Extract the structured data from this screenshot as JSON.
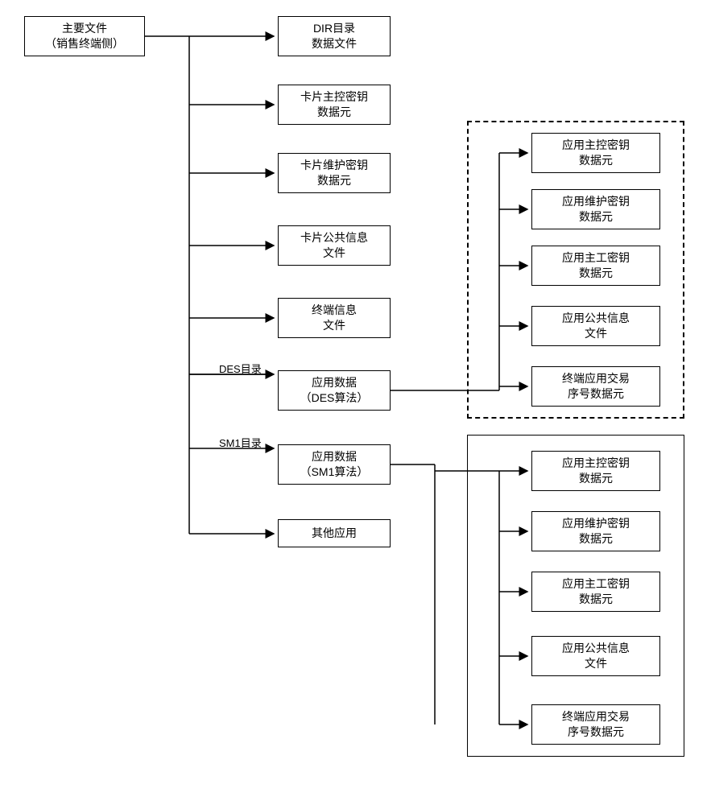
{
  "root": {
    "line1": "主要文件",
    "line2": "（销售终端侧）"
  },
  "col2": {
    "b1": {
      "line1": "DIR目录",
      "line2": "数据文件"
    },
    "b2": {
      "line1": "卡片主控密钥",
      "line2": "数据元"
    },
    "b3": {
      "line1": "卡片维护密钥",
      "line2": "数据元"
    },
    "b4": {
      "line1": "卡片公共信息",
      "line2": "文件"
    },
    "b5": {
      "line1": "终端信息",
      "line2": "文件"
    },
    "b6": {
      "line1": "应用数据",
      "line2": "（DES算法）",
      "label": "DES目录"
    },
    "b7": {
      "line1": "应用数据",
      "line2": "（SM1算法）",
      "label": "SM1目录"
    },
    "b8": {
      "line1": "其他应用"
    }
  },
  "group_des": {
    "g1": {
      "line1": "应用主控密钥",
      "line2": "数据元"
    },
    "g2": {
      "line1": "应用维护密钥",
      "line2": "数据元"
    },
    "g3": {
      "line1": "应用主工密钥",
      "line2": "数据元"
    },
    "g4": {
      "line1": "应用公共信息",
      "line2": "文件"
    },
    "g5": {
      "line1": "终端应用交易",
      "line2": "序号数据元"
    }
  },
  "group_sm1": {
    "g1": {
      "line1": "应用主控密钥",
      "line2": "数据元"
    },
    "g2": {
      "line1": "应用维护密钥",
      "line2": "数据元"
    },
    "g3": {
      "line1": "应用主工密钥",
      "line2": "数据元"
    },
    "g4": {
      "line1": "应用公共信息",
      "line2": "文件"
    },
    "g5": {
      "line1": "终端应用交易",
      "line2": "序号数据元"
    }
  }
}
